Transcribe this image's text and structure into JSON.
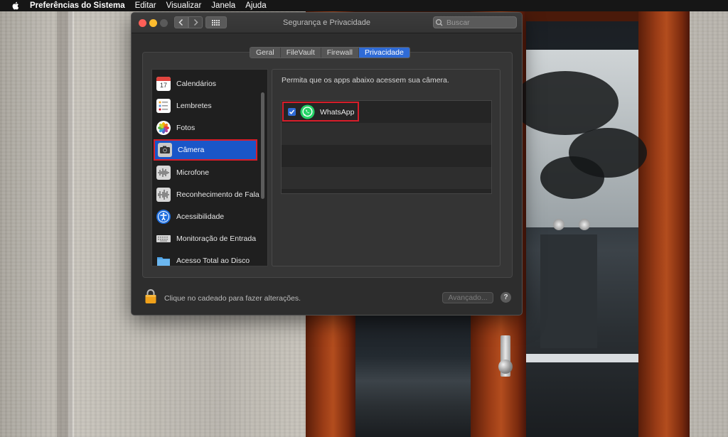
{
  "menubar": {
    "apple_icon": "apple-logo-icon",
    "app_name": "Preferências do Sistema",
    "items": [
      "Editar",
      "Visualizar",
      "Janela",
      "Ajuda"
    ]
  },
  "window": {
    "title": "Segurança e Privacidade",
    "search_placeholder": "Buscar",
    "tabs": [
      {
        "label": "Geral",
        "active": false
      },
      {
        "label": "FileVault",
        "active": false
      },
      {
        "label": "Firewall",
        "active": false
      },
      {
        "label": "Privacidade",
        "active": true
      }
    ],
    "sidebar": {
      "items": [
        {
          "label": "Calendários",
          "icon": "calendar-icon",
          "selected": false
        },
        {
          "label": "Lembretes",
          "icon": "reminders-icon",
          "selected": false
        },
        {
          "label": "Fotos",
          "icon": "photos-icon",
          "selected": false
        },
        {
          "label": "Câmera",
          "icon": "camera-icon",
          "selected": true
        },
        {
          "label": "Microfone",
          "icon": "microphone-icon",
          "selected": false
        },
        {
          "label": "Reconhecimento de Fala",
          "icon": "speech-recognition-icon",
          "selected": false
        },
        {
          "label": "Acessibilidade",
          "icon": "accessibility-icon",
          "selected": false
        },
        {
          "label": "Monitoração de Entrada",
          "icon": "keyboard-icon",
          "selected": false
        },
        {
          "label": "Acesso Total ao Disco",
          "icon": "folder-icon",
          "selected": false
        }
      ]
    },
    "content": {
      "description": "Permita que os apps abaixo acessem sua câmera.",
      "apps": [
        {
          "name": "WhatsApp",
          "checked": true,
          "icon": "whatsapp-icon"
        }
      ]
    },
    "footer": {
      "lock_text": "Clique no cadeado para fazer alterações.",
      "advanced_label": "Avançado...",
      "help_label": "?"
    },
    "calendar_icon_day": "17"
  },
  "colors": {
    "accent": "#1a56c8",
    "highlight_border": "#d71d2a",
    "whatsapp_green": "#25d366"
  }
}
